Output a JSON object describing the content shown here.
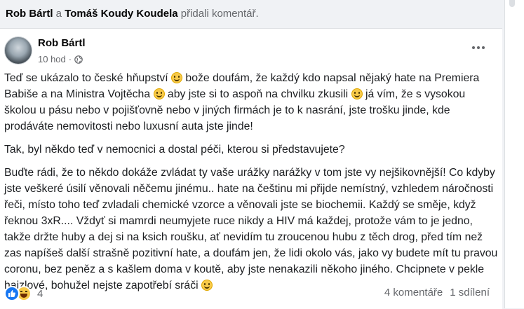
{
  "header": {
    "actor_1": "Rob Bártl",
    "connector": "a",
    "actor_2": "Tomáš Koudy Koudela",
    "action": "přidali komentář."
  },
  "post": {
    "author": "Rob Bártl",
    "time": "10 hod",
    "separator": "·",
    "audience_icon": "globe-icon",
    "paragraphs": {
      "p1": {
        "s1": "Teď se ukázalo to české hňupství ",
        "s2": " bože doufám, že každý kdo napsal nějaký hate na Premiera Babiše a na Ministra Vojtěcha ",
        "s3": " aby jste si to aspoň na chvilku zkusili ",
        "s4": " já vím, že s vysokou školou u pásu nebo v pojišťovně nebo v jiných firmách je to k nasrání, jste trošku jinde, kde prodáváte nemovitosti nebo luxusní auta jste jinde!"
      },
      "p2": "Tak, byl někdo teď v nemocnici a dostal péči, kterou si představujete?",
      "p3": {
        "s1": "Buďte rádi, že to někdo dokáže zvládat ty vaše urážky narážky v tom jste vy nejšikovnější! Co kdyby jste veškeré úsilí věnovali něčemu jinému.. hate na češtinu mi přijde nemístný, vzhledem náročnosti řeči, místo toho teď zvladali chemické vzorce a věnovali jste se biochemii. Každý se směje, když řeknou 3xR.... Vždyť si mamrdi neumyjete ruce nikdy a HIV má každej, protože vám to je jedno, takže držte huby a dej si na ksich roušku, ať nevidím tu zroucenou hubu z těch drog, před tím než zas napíšeš další strašně pozitivní hate, a doufám jen, že lidi okolo vás, jako vy budete mít tu pravou coronu, bez peněz a s kašlem doma v koutě, aby jste nenakazili někoho jiného. Chcipnete v pekle hajzlové, bohužel nejste zapotřebí sráči "
      }
    }
  },
  "reactions": {
    "count": "4",
    "icons": [
      "like-icon",
      "haha-icon"
    ]
  },
  "stats": {
    "comments": "4 komentáře",
    "shares": "1 sdílení"
  },
  "colors": {
    "like_blue": "#1877f2",
    "secondary_text": "#65676b",
    "emoji_yellow": "#f7c948"
  }
}
